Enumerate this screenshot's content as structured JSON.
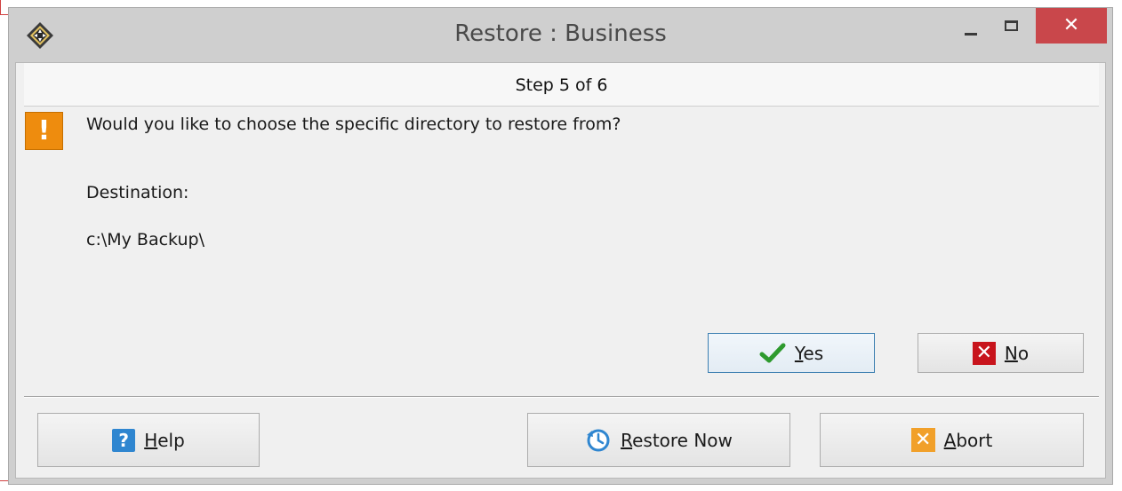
{
  "window": {
    "title": "Restore : Business",
    "close_glyph": "✕"
  },
  "step": {
    "text": "Step 5 of 6"
  },
  "prompt": {
    "question": "Would you like to choose the specific directory to restore from?",
    "destination_label": "Destination:",
    "destination_path": "c:\\My Backup\\",
    "icon": "exclamation-icon",
    "icon_glyph": "!"
  },
  "answers": {
    "yes": {
      "access_key": "Y",
      "rest": "es",
      "icon": "checkmark-icon"
    },
    "no": {
      "access_key": "N",
      "rest": "o",
      "icon": "x-icon",
      "icon_glyph": "✕"
    }
  },
  "footer": {
    "help": {
      "access_key": "H",
      "rest": "elp",
      "icon": "help-icon",
      "icon_glyph": "?"
    },
    "restore_now": {
      "access_key": "R",
      "rest": "estore Now",
      "icon": "clock-restore-icon"
    },
    "abort": {
      "access_key": "A",
      "rest": "bort",
      "icon": "abort-icon",
      "icon_glyph": "✕"
    }
  },
  "colors": {
    "close_button": "#c9474b",
    "warning": "#ee8c0e",
    "yes_border": "#3c7fb1",
    "no_icon": "#c8141c",
    "help_icon": "#2f86d0",
    "abort_icon": "#f1a02a"
  }
}
